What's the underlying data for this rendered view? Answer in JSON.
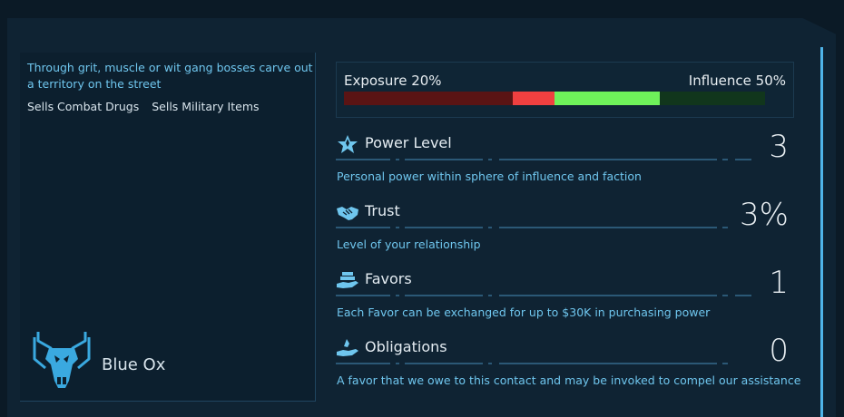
{
  "contact": {
    "description": "Through grit, muscle or wit gang bosses carve out a territory on the street",
    "tags": [
      "Sells Combat Drugs",
      "Sells Military Items"
    ],
    "name": "Blue Ox",
    "emblem_icon": "ox-skull-icon"
  },
  "relationship_bar": {
    "exposure_label": "Exposure 20%",
    "influence_label": "Influence 50%",
    "exposure_percent": 20,
    "influence_percent": 50,
    "colors": {
      "exposure_dark": "#5a1414",
      "exposure_bright": "#f04040",
      "influence_bright": "#6ef25a",
      "influence_dark": "#11361c"
    }
  },
  "stats": [
    {
      "title": "Power Level",
      "value": "3",
      "description": "Personal power within sphere of influence and faction",
      "icon": "power-star-icon"
    },
    {
      "title": "Trust",
      "value": "3%",
      "description": "Level of your relationship",
      "icon": "handshake-icon"
    },
    {
      "title": "Favors",
      "value": "1",
      "description": "Each Favor can be exchanged for up to $30K in purchasing power",
      "icon": "favor-hand-icon"
    },
    {
      "title": "Obligations",
      "value": "0",
      "description": "A favor that we owe to this contact and may be invoked to compel our assistance",
      "icon": "obligation-hand-icon"
    }
  ],
  "colors": {
    "accent": "#4fb4e8",
    "text_cyan": "#6fc6ee",
    "text_white": "#e4ecf2",
    "panel_bg": "#0f2333"
  }
}
